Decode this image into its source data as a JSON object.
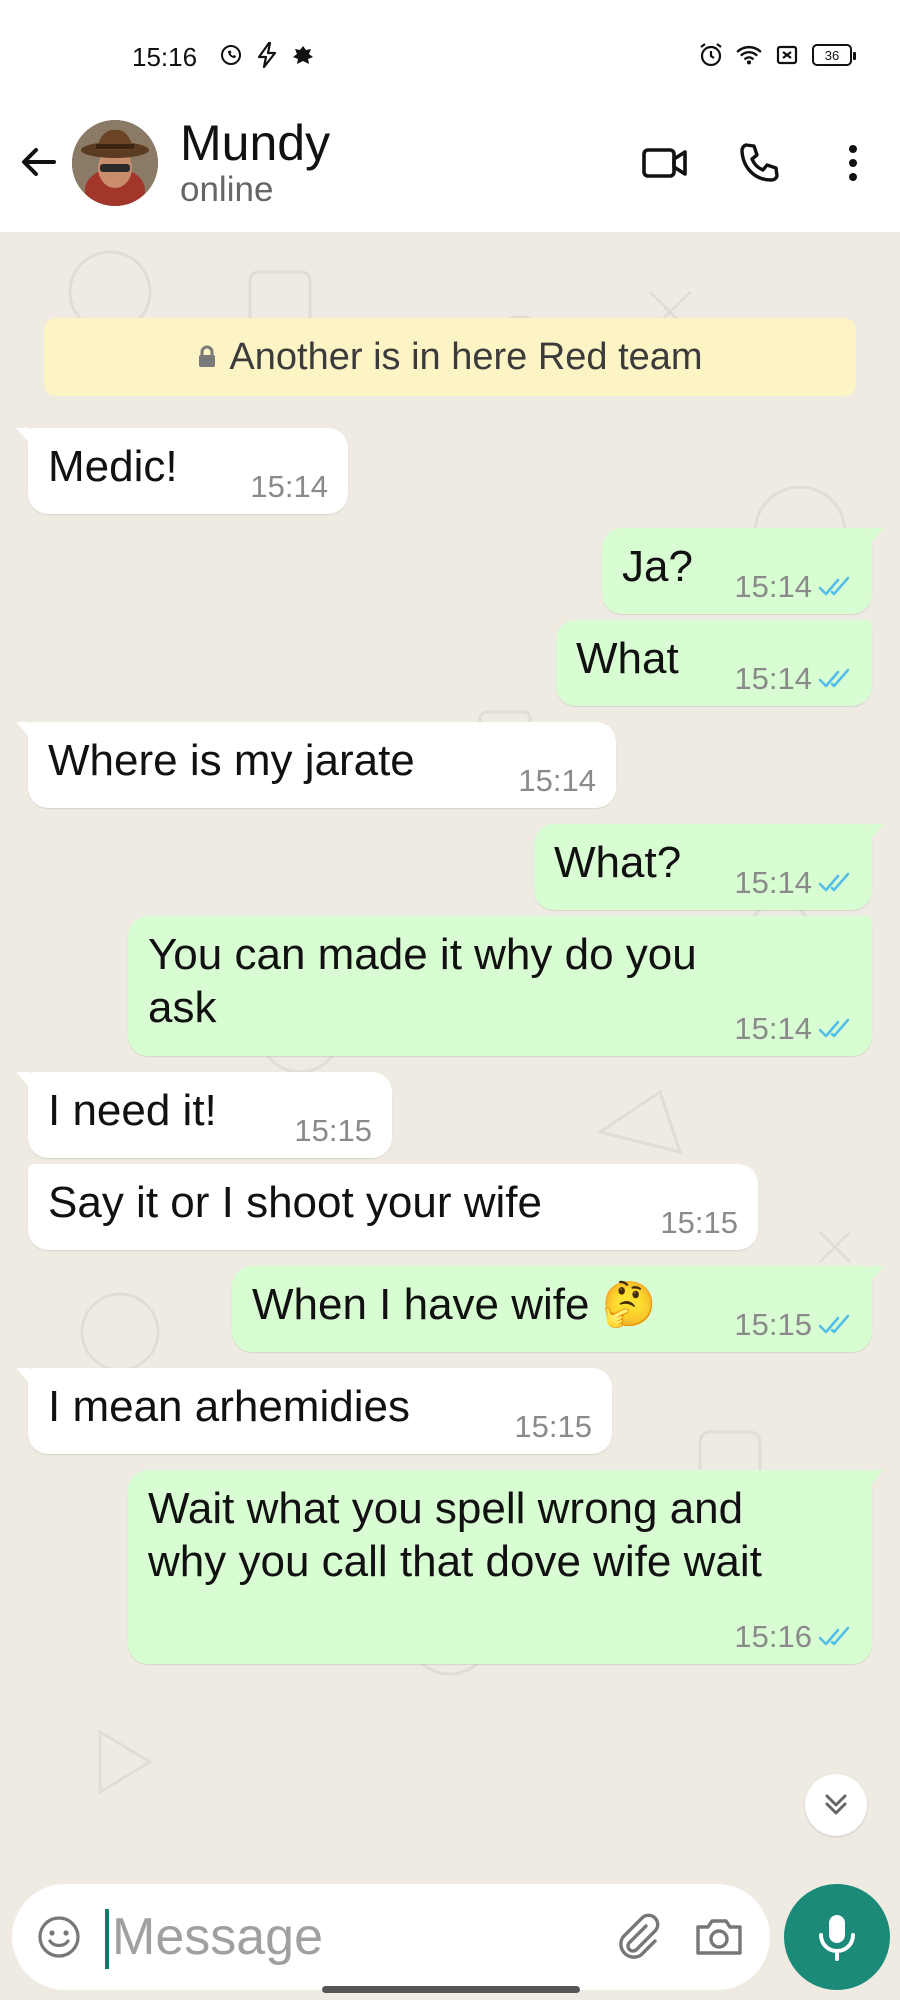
{
  "status_bar": {
    "time": "15:16",
    "battery": "36",
    "left_icons": [
      "whatsapp-icon",
      "flash-icon",
      "app-icon"
    ],
    "right_icons": [
      "alarm-icon",
      "wifi-icon",
      "no-sim-icon",
      "battery-icon"
    ]
  },
  "header": {
    "contact_name": "Mundy",
    "contact_status": "online",
    "icons": [
      "back-arrow-icon",
      "video-call-icon",
      "voice-call-icon",
      "more-options-icon"
    ]
  },
  "chat": {
    "system_banner": "Another is in here Red team",
    "messages": [
      {
        "direction": "in",
        "text": "Medic!",
        "time": "15:14"
      },
      {
        "direction": "out",
        "text": "Ja?",
        "time": "15:14",
        "status": "read"
      },
      {
        "direction": "out",
        "text": "What",
        "time": "15:14",
        "status": "read"
      },
      {
        "direction": "in",
        "text": "Where is my jarate",
        "time": "15:14"
      },
      {
        "direction": "out",
        "text": "What?",
        "time": "15:14",
        "status": "read"
      },
      {
        "direction": "out",
        "text": "You can made it why do you ask",
        "time": "15:14",
        "status": "read"
      },
      {
        "direction": "in",
        "text": "I need it!",
        "time": "15:15"
      },
      {
        "direction": "in",
        "text": "Say it or I shoot your wife",
        "time": "15:15"
      },
      {
        "direction": "out",
        "text": "When I have wife 🤔",
        "time": "15:15",
        "status": "read"
      },
      {
        "direction": "in",
        "text": "I mean arhemidies",
        "time": "15:15"
      },
      {
        "direction": "out",
        "text": "Wait what you spell wrong and why you call that dove wife wait",
        "time": "15:16",
        "status": "read"
      }
    ]
  },
  "composer": {
    "placeholder": "Message",
    "value": ""
  },
  "colors": {
    "incoming_bubble": "#ffffff",
    "outgoing_bubble": "#d9fdd3",
    "chat_background": "#efeae2",
    "read_tick": "#53bdeb",
    "mic_button": "#1b8a78",
    "banner": "#fdf4c5"
  }
}
